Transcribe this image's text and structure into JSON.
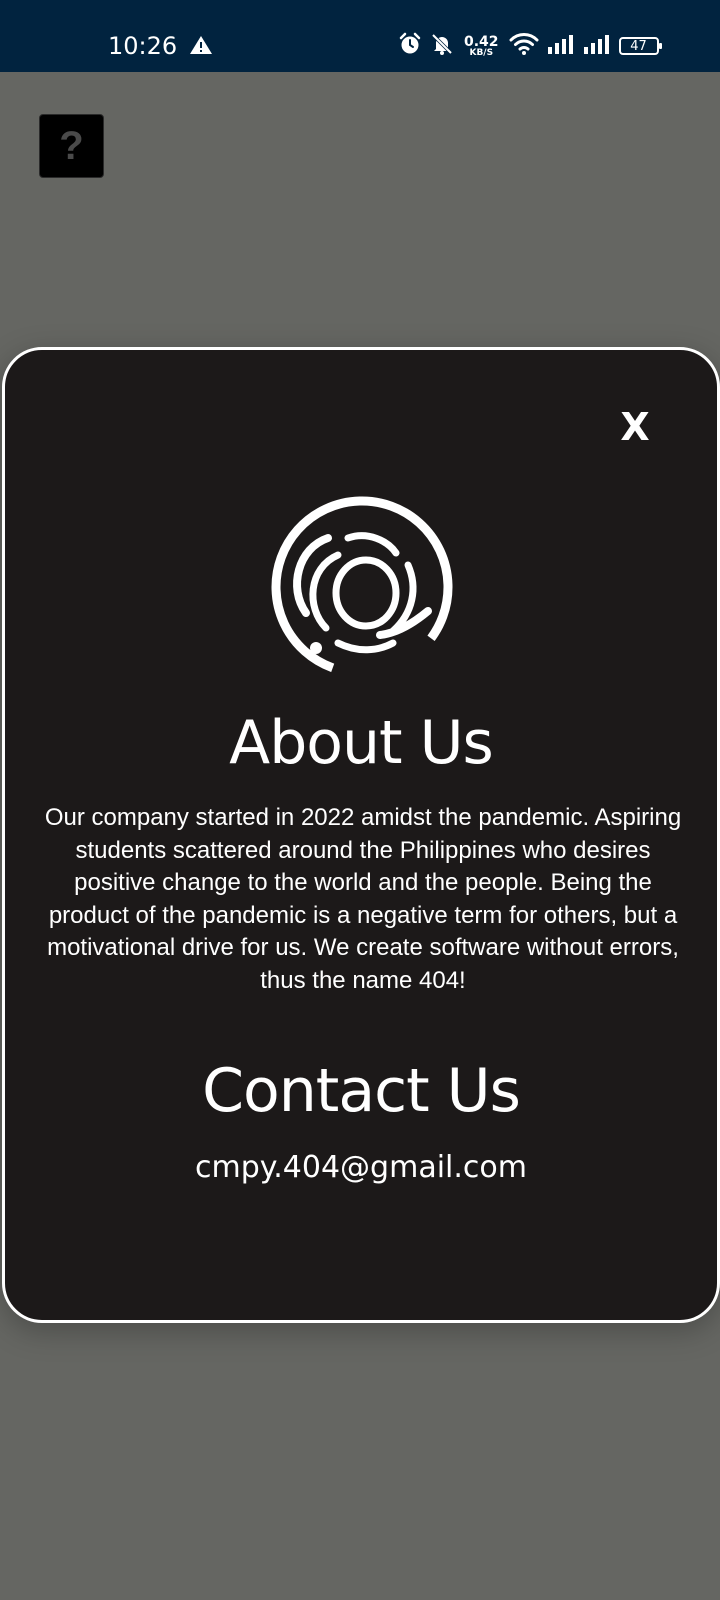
{
  "status_bar": {
    "time": "10:26",
    "net_speed_value": "0.42",
    "net_speed_unit": "KB/S",
    "battery": "47",
    "icons": [
      "warning-icon",
      "alarm-icon",
      "mute-icon",
      "wifi-icon",
      "signal-icon",
      "signal-icon",
      "battery-icon"
    ]
  },
  "help_button": {
    "label": "?"
  },
  "modal": {
    "close_label": "X",
    "logo_icon": "company-logo-icon",
    "about_title": "About Us",
    "about_body": "Our company started in 2022 amidst the pandemic. Aspiring students scattered around the Philippines who desires positive change to the world and the people. Being the product of the pandemic is a negative term for others, but a motivational drive for us. We create software without errors, thus the name 404!",
    "contact_title": "Contact Us",
    "contact_email": "cmpy.404@gmail.com"
  },
  "colors": {
    "status_bar_bg": "#01233f",
    "backdrop": "#656662",
    "modal_bg": "#1c1919",
    "modal_border": "#ffffff",
    "text": "#ffffff"
  }
}
